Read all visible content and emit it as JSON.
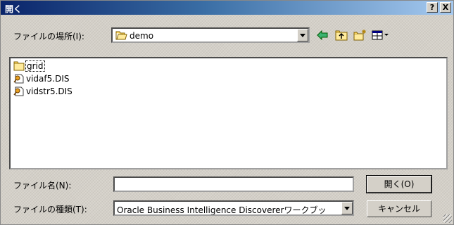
{
  "window": {
    "title": "開く"
  },
  "titlebar": {
    "help_label": "?",
    "close_label": "X"
  },
  "location": {
    "label": "ファイルの場所(I):",
    "value": "demo"
  },
  "files": [
    {
      "name": "grid",
      "icon": "folder-icon",
      "selected": true
    },
    {
      "name": "vidaf5.DIS",
      "icon": "document-key-icon"
    },
    {
      "name": "vidstr5.DIS",
      "icon": "document-key-icon"
    }
  ],
  "filename": {
    "label": "ファイル名(N):",
    "value": ""
  },
  "filetype": {
    "label": "ファイルの種類(T):",
    "value": "Oracle Business Intelligence Discovererワークブッ"
  },
  "buttons": {
    "open_label": "開く(O)",
    "cancel_label": "キャンセル"
  },
  "colors": {
    "dialog_bg": "#d4d0c8",
    "title_start": "#0a246a",
    "title_end": "#a6caf0"
  }
}
